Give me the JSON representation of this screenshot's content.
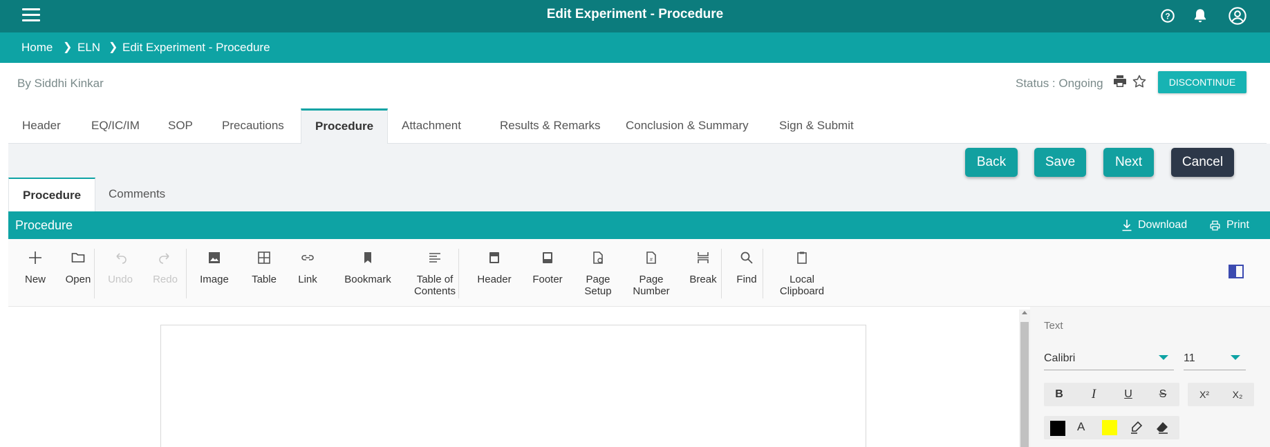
{
  "app": {
    "title": "Edit Experiment - Procedure"
  },
  "breadcrumb": [
    "Home",
    "ELN",
    "Edit Experiment - Procedure"
  ],
  "author": "By Siddhi Kinkar",
  "status": "Status : Ongoing",
  "discontinue_label": "DISCONTINUE",
  "tabs": [
    "Header",
    "EQ/IC/IM",
    "SOP",
    "Precautions",
    "Procedure",
    "Attachment",
    "Results & Remarks",
    "Conclusion & Summary",
    "Sign & Submit"
  ],
  "active_tab": "Procedure",
  "actions": {
    "back": "Back",
    "save": "Save",
    "next": "Next",
    "cancel": "Cancel"
  },
  "subtabs": [
    "Procedure",
    "Comments"
  ],
  "section": {
    "title": "Procedure",
    "download": "Download",
    "print": "Print"
  },
  "toolbar": {
    "new": "New",
    "open": "Open",
    "undo": "Undo",
    "redo": "Redo",
    "image": "Image",
    "table": "Table",
    "link": "Link",
    "bookmark": "Bookmark",
    "toc_1": "Table of",
    "toc_2": "Contents",
    "header": "Header",
    "footer": "Footer",
    "page_setup_1": "Page",
    "page_setup_2": "Setup",
    "page_number_1": "Page",
    "page_number_2": "Number",
    "break": "Break",
    "find": "Find",
    "clipboard_1": "Local",
    "clipboard_2": "Clipboard"
  },
  "properties": {
    "section_label": "Text",
    "font_family": "Calibri",
    "font_size": "11",
    "bold": "B",
    "italic": "I",
    "underline": "U",
    "strike": "S",
    "superscript": "X²",
    "subscript": "X₂",
    "font_color_letter": "A"
  },
  "colors": {
    "primary_dark": "#0c7c7d",
    "primary": "#0ea3a4",
    "cancel": "#2d3849",
    "highlight": "#ffff00",
    "font_color": "#000000"
  }
}
